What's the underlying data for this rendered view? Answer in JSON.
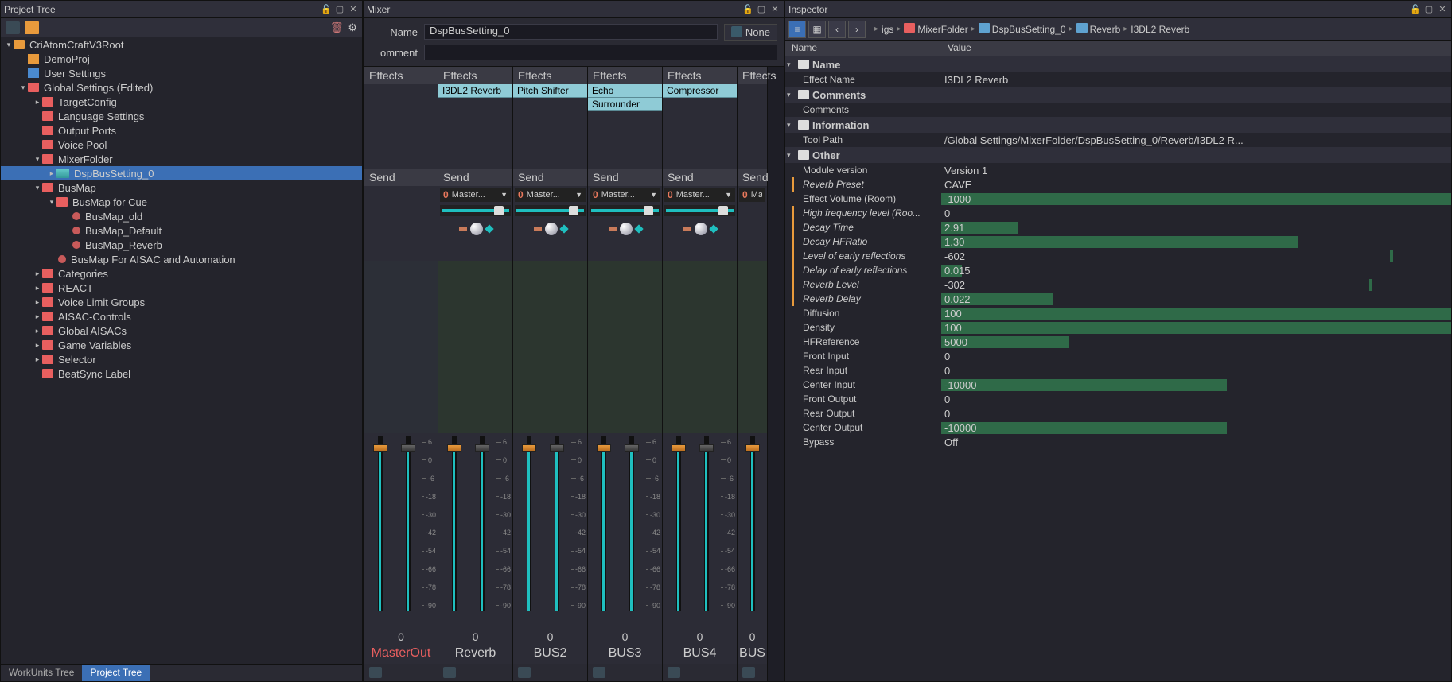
{
  "left": {
    "title": "Project Tree",
    "tree": [
      {
        "d": 0,
        "arrow": "▾",
        "ic": "orange",
        "label": "CriAtomCraftV3Root"
      },
      {
        "d": 1,
        "arrow": "",
        "ic": "proj",
        "label": "DemoProj"
      },
      {
        "d": 1,
        "arrow": "",
        "ic": "user",
        "label": "User Settings"
      },
      {
        "d": 1,
        "arrow": "▾",
        "ic": "red",
        "label": "Global Settings (Edited)"
      },
      {
        "d": 2,
        "arrow": "▸",
        "ic": "red",
        "label": "TargetConfig"
      },
      {
        "d": 2,
        "arrow": "",
        "ic": "red",
        "label": "Language Settings"
      },
      {
        "d": 2,
        "arrow": "",
        "ic": "red",
        "label": "Output Ports"
      },
      {
        "d": 2,
        "arrow": "",
        "ic": "red",
        "label": "Voice Pool"
      },
      {
        "d": 2,
        "arrow": "▾",
        "ic": "red",
        "label": "MixerFolder"
      },
      {
        "d": 3,
        "arrow": "▸",
        "ic": "teal",
        "label": "DspBusSetting_0",
        "sel": true
      },
      {
        "d": 2,
        "arrow": "▾",
        "ic": "red",
        "label": "BusMap"
      },
      {
        "d": 3,
        "arrow": "▾",
        "ic": "red",
        "label": "BusMap for Cue"
      },
      {
        "d": 4,
        "arrow": "",
        "ic": "map",
        "label": "BusMap_old"
      },
      {
        "d": 4,
        "arrow": "",
        "ic": "map",
        "label": "BusMap_Default"
      },
      {
        "d": 4,
        "arrow": "",
        "ic": "map",
        "label": "BusMap_Reverb"
      },
      {
        "d": 3,
        "arrow": "",
        "ic": "map",
        "label": "BusMap For AISAC and Automation"
      },
      {
        "d": 2,
        "arrow": "▸",
        "ic": "red",
        "label": "Categories"
      },
      {
        "d": 2,
        "arrow": "▸",
        "ic": "red",
        "label": "REACT"
      },
      {
        "d": 2,
        "arrow": "▸",
        "ic": "red",
        "label": "Voice Limit Groups"
      },
      {
        "d": 2,
        "arrow": "▸",
        "ic": "red",
        "label": "AISAC-Controls"
      },
      {
        "d": 2,
        "arrow": "▸",
        "ic": "red",
        "label": "Global AISACs"
      },
      {
        "d": 2,
        "arrow": "▸",
        "ic": "red",
        "label": "Game Variables"
      },
      {
        "d": 2,
        "arrow": "▸",
        "ic": "red",
        "label": "Selector"
      },
      {
        "d": 2,
        "arrow": "",
        "ic": "red",
        "label": "BeatSync Label"
      }
    ],
    "tabs": [
      "WorkUnits Tree",
      "Project Tree"
    ],
    "activeTab": 1
  },
  "mixer": {
    "title": "Mixer",
    "nameLabel": "Name",
    "nameValue": "DspBusSetting_0",
    "none": "None",
    "commentLabel": "omment",
    "commentValue": "",
    "effectsHeader": "Effects",
    "sendHeader": "Send",
    "sendZero": "0",
    "sendTarget": "Master...",
    "scale": [
      "6",
      "0",
      "-6",
      "-18",
      "-30",
      "-42",
      "-54",
      "-66",
      "-78",
      "-90"
    ],
    "chVal": "0",
    "channels": [
      {
        "name": "MasterOut",
        "master": true,
        "fx": [],
        "send": false,
        "dim": false
      },
      {
        "name": "Reverb",
        "fx": [
          "I3DL2 Reverb"
        ],
        "send": true,
        "dim": true
      },
      {
        "name": "BUS2",
        "fx": [
          "Pitch Shifter"
        ],
        "send": true,
        "dim": true
      },
      {
        "name": "BUS3",
        "fx": [
          "Echo",
          "Surrounder"
        ],
        "send": true,
        "dim": true
      },
      {
        "name": "BUS4",
        "fx": [
          "Compressor"
        ],
        "send": true,
        "dim": true
      },
      {
        "name": "BUS",
        "fx": [],
        "send": true,
        "dim": true,
        "cut": true
      }
    ]
  },
  "inspector": {
    "title": "Inspector",
    "crumbs": [
      "igs",
      "MixerFolder",
      "DspBusSetting_0",
      "Reverb",
      "I3DL2 Reverb"
    ],
    "hdrName": "Name",
    "hdrValue": "Value",
    "groups": [
      {
        "title": "Name",
        "rows": [
          {
            "n": "Effect Name",
            "v": "I3DL2 Reverb"
          }
        ]
      },
      {
        "title": "Comments",
        "rows": [
          {
            "n": "Comments",
            "v": ""
          }
        ]
      },
      {
        "title": "Information",
        "rows": [
          {
            "n": "Tool Path",
            "v": "/Global Settings/MixerFolder/DspBusSetting_0/Reverb/I3DL2 R..."
          }
        ]
      },
      {
        "title": "Other",
        "rows": [
          {
            "n": "Module version",
            "v": "Version 1"
          },
          {
            "n": "Reverb Preset",
            "v": "CAVE",
            "o": true,
            "it": true
          },
          {
            "n": "Effect Volume (Room)",
            "v": "-1000",
            "bar": 100
          },
          {
            "n": "High frequency level (Roo...",
            "v": "0",
            "o": true,
            "it": true
          },
          {
            "n": "Decay Time",
            "v": "2.91",
            "o": true,
            "it": true,
            "bar": 15
          },
          {
            "n": "Decay HFRatio",
            "v": "1.30",
            "o": true,
            "it": true,
            "bar": 70
          },
          {
            "n": "Level of early reflections",
            "v": "-602",
            "o": true,
            "it": true,
            "bar": 88,
            "far": true
          },
          {
            "n": "Delay of early reflections",
            "v": "0.015",
            "o": true,
            "it": true,
            "bar": 4
          },
          {
            "n": "Reverb Level",
            "v": "-302",
            "o": true,
            "it": true,
            "bar": 84,
            "far": true
          },
          {
            "n": "Reverb Delay",
            "v": "0.022",
            "o": true,
            "it": true,
            "bar": 22
          },
          {
            "n": "Diffusion",
            "v": "100",
            "bar": 100
          },
          {
            "n": "Density",
            "v": "100",
            "bar": 100
          },
          {
            "n": "HFReference",
            "v": "5000",
            "bar": 25
          },
          {
            "n": "Front Input",
            "v": "0"
          },
          {
            "n": "Rear Input",
            "v": "0"
          },
          {
            "n": "Center Input",
            "v": "-10000",
            "neg": true,
            "bar": 56
          },
          {
            "n": "Front Output",
            "v": "0"
          },
          {
            "n": "Rear Output",
            "v": "0"
          },
          {
            "n": "Center Output",
            "v": "-10000",
            "neg": true,
            "bar": 56
          },
          {
            "n": "Bypass",
            "v": "Off"
          }
        ]
      }
    ]
  }
}
